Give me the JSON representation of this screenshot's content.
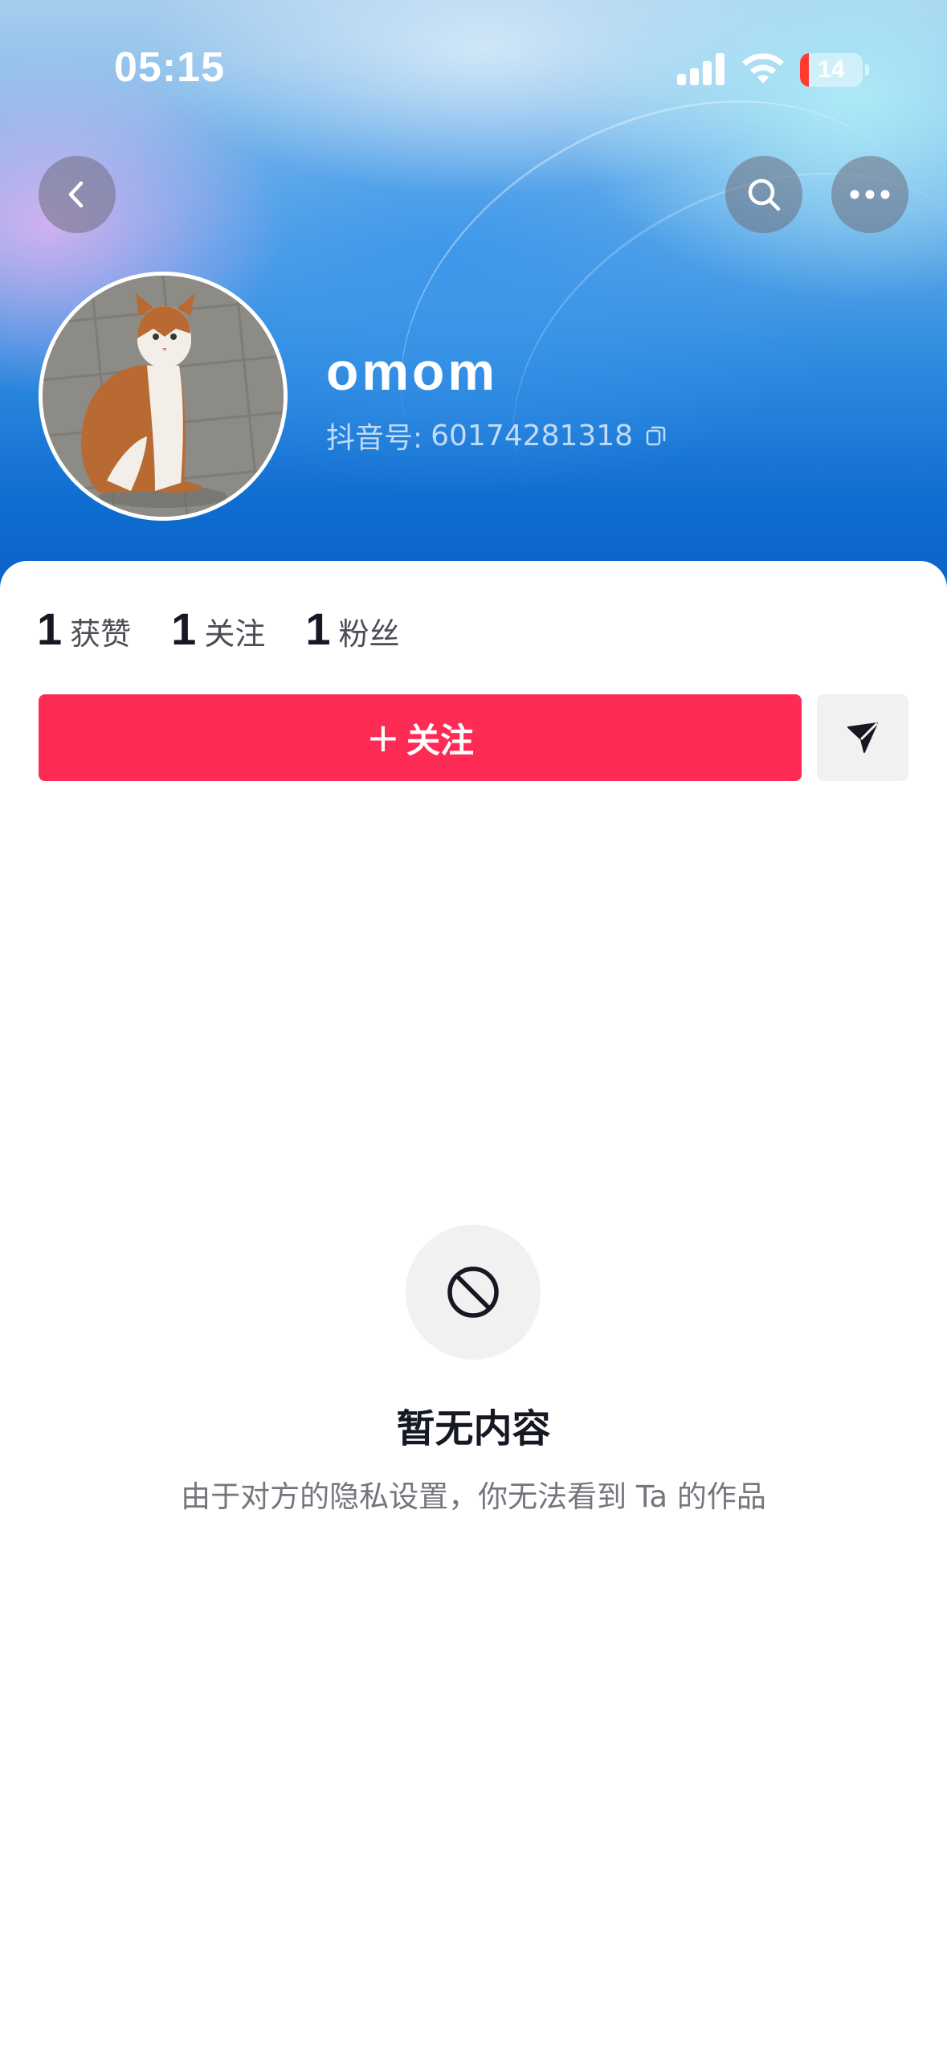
{
  "status_bar": {
    "time": "05:15",
    "battery_level": "14",
    "battery_fraction": 0.14,
    "signal_bars": 4
  },
  "header": {
    "back_icon": "chevron-left-icon",
    "search_icon": "search-icon",
    "more_icon": "more-horizontal-icon"
  },
  "profile": {
    "nickname": "omom",
    "id_label": "抖音号:",
    "id_value": "60174281318",
    "avatar_desc_icon": "cat-photo"
  },
  "stats": [
    {
      "count": "1",
      "label": "获赞"
    },
    {
      "count": "1",
      "label": "关注"
    },
    {
      "count": "1",
      "label": "粉丝"
    }
  ],
  "actions": {
    "follow_plus": "+",
    "follow_label": "关注",
    "message_icon": "send-icon",
    "follow_color": "#fe2c55"
  },
  "empty_state": {
    "icon": "block-icon",
    "title": "暂无内容",
    "description": "由于对方的隐私设置，你无法看到 Ta 的作品"
  }
}
